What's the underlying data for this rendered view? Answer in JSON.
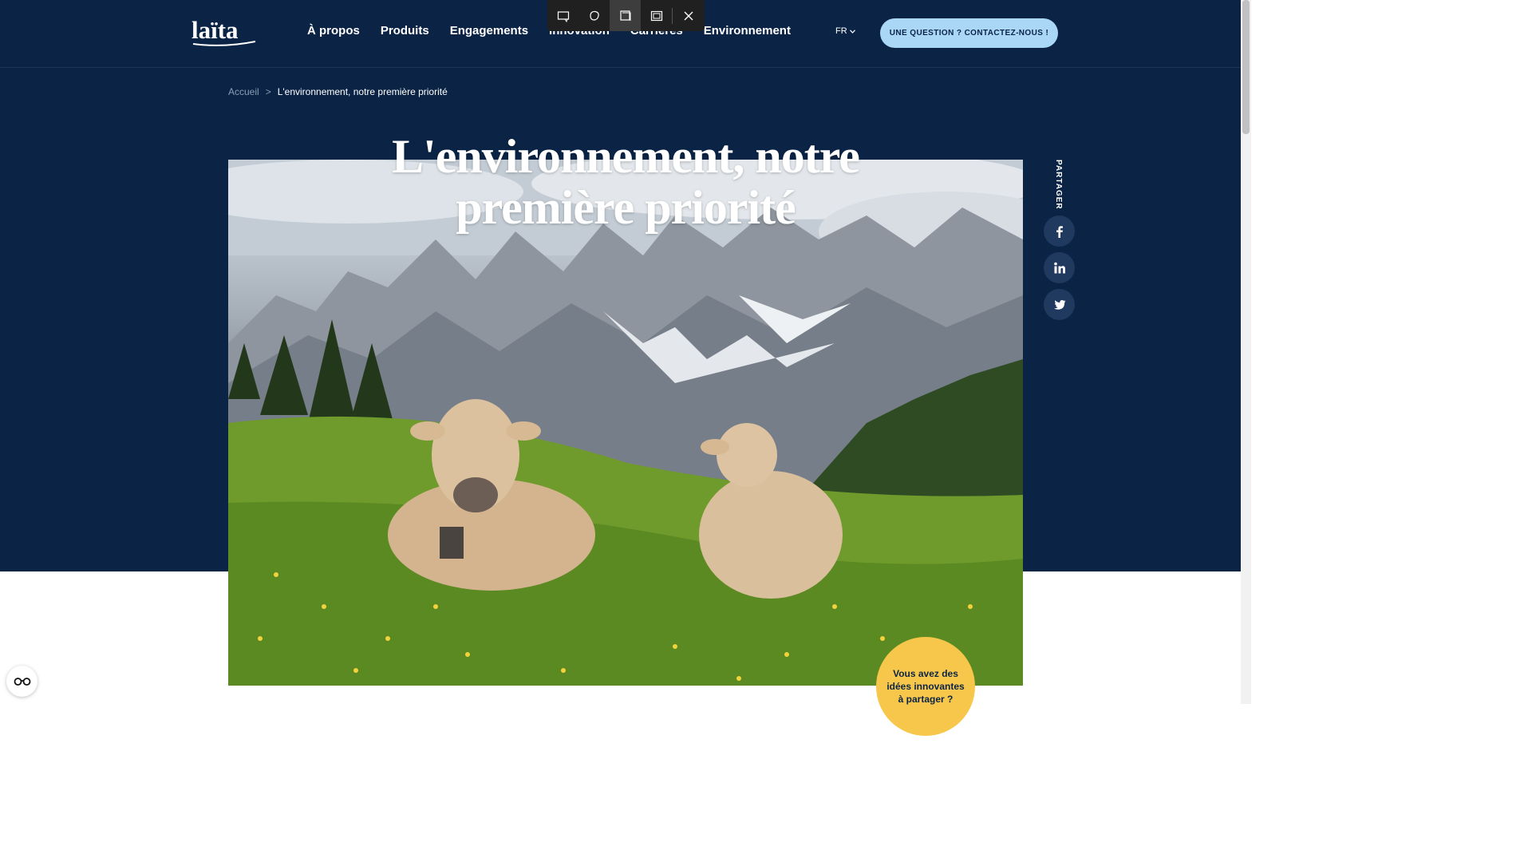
{
  "header": {
    "logo_text": "laïta",
    "nav": [
      {
        "label": "À propos"
      },
      {
        "label": "Produits"
      },
      {
        "label": "Engagements"
      },
      {
        "label": "Innovation"
      },
      {
        "label": "Carrières"
      },
      {
        "label": "Environnement"
      }
    ],
    "language": "FR",
    "contact_button": "UNE QUESTION ? CONTACTEZ-NOUS !"
  },
  "snip_toolbar": {
    "tools": [
      "rectangle-snip-icon",
      "freeform-snip-icon",
      "window-snip-icon",
      "fullscreen-snip-icon",
      "close-icon"
    ],
    "active_tool": "window-snip-icon"
  },
  "breadcrumb": {
    "home": "Accueil",
    "separator": ">",
    "current": "L'environnement, notre première priorité"
  },
  "page": {
    "title_line1": "L'environnement, notre",
    "title_line2": "première priorité",
    "hero_image": "cows-in-alpine-meadow"
  },
  "share": {
    "label": "PARTAGER",
    "networks": [
      "facebook-icon",
      "linkedin-icon",
      "twitter-icon"
    ]
  },
  "ideas_bubble": {
    "text": "Vous avez des idées innovantes à partager ?"
  },
  "colors": {
    "navy": "#0b2446",
    "contact_button": "#a9d7f5",
    "ideas_bubble": "#f7c74b"
  }
}
